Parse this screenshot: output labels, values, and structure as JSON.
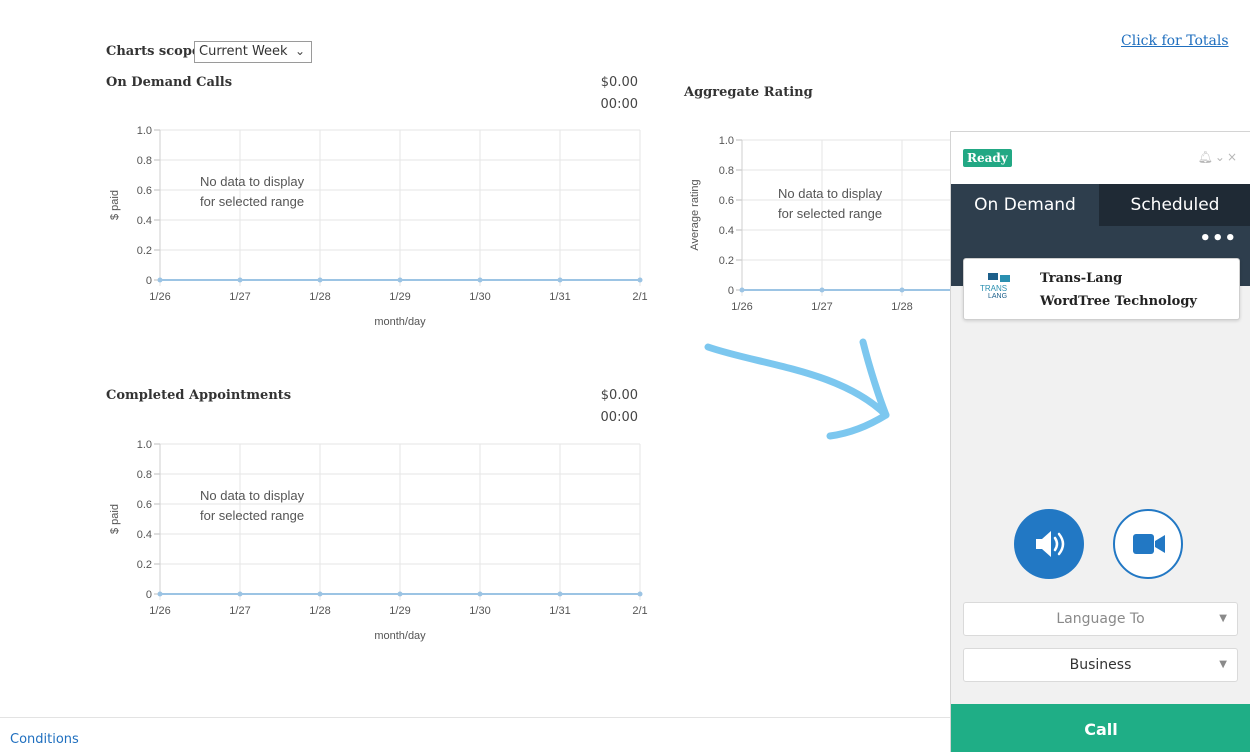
{
  "header": {
    "scope_label": "Charts scope",
    "scope_value": "Current Week",
    "totals_link": "Click for Totals"
  },
  "charts": {
    "on_demand": {
      "title": "On Demand Calls",
      "amount": "$0.00",
      "duration": "00:00"
    },
    "aggregate": {
      "title": "Aggregate Rating"
    },
    "completed": {
      "title": "Completed Appointments",
      "amount": "$0.00",
      "duration": "00:00"
    }
  },
  "chart_data": [
    {
      "type": "line",
      "x": [
        "1/26",
        "1/27",
        "1/28",
        "1/29",
        "1/30",
        "1/31",
        "2/1"
      ],
      "y": [
        0,
        0,
        0,
        0,
        0,
        0,
        0
      ],
      "yticks": [
        "0",
        "0.2",
        "0.4",
        "0.6",
        "0.8",
        "1.0"
      ],
      "ylim": [
        0,
        1.0
      ],
      "xlabel": "month/day",
      "ylabel": "$ paid",
      "empty_message_line1": "No data to display",
      "empty_message_line2": "for selected range",
      "color": "#9cc4e4",
      "grid": true
    },
    {
      "type": "line",
      "x": [
        "1/26",
        "1/27",
        "1/28"
      ],
      "y": [
        0,
        0,
        0
      ],
      "yticks": [
        "0",
        "0.2",
        "0.4",
        "0.6",
        "0.8",
        "1.0"
      ],
      "ylim": [
        0,
        1.0
      ],
      "xlabel": "",
      "ylabel": "Average rating",
      "empty_message_line1": "No data to display",
      "empty_message_line2": "for selected range",
      "color": "#9cc4e4",
      "grid": true
    },
    {
      "type": "line",
      "x": [
        "1/26",
        "1/27",
        "1/28",
        "1/29",
        "1/30",
        "1/31",
        "2/1"
      ],
      "y": [
        0,
        0,
        0,
        0,
        0,
        0,
        0
      ],
      "yticks": [
        "0",
        "0.2",
        "0.4",
        "0.6",
        "0.8",
        "1.0"
      ],
      "ylim": [
        0,
        1.0
      ],
      "xlabel": "month/day",
      "ylabel": "$ paid",
      "empty_message_line1": "No data to display",
      "empty_message_line2": "for selected range",
      "color": "#9cc4e4",
      "grid": true
    }
  ],
  "footer": {
    "conditions_link": "Conditions"
  },
  "widget": {
    "status": "Ready",
    "tabs": [
      "On Demand",
      "Scheduled"
    ],
    "more": "•••",
    "provider": {
      "name": "Trans-Lang",
      "company": "WordTree Technology"
    },
    "language_placeholder": "Language To",
    "category_value": "Business",
    "call_label": "Call",
    "colors": {
      "accent": "#2278c4",
      "ready": "#22a884",
      "call": "#1fae86",
      "tabbar": "#2e3e4d"
    }
  }
}
